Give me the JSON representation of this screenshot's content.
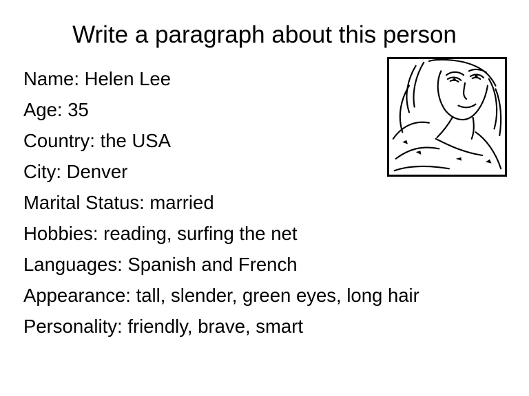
{
  "heading": "Write a paragraph about this person",
  "profile": {
    "lines": [
      "Name: Helen Lee",
      "Age: 35",
      "Country: the USA",
      "City: Denver",
      "Marital Status: married",
      "Hobbies: reading, surfing the net",
      "Languages: Spanish and French",
      "Appearance: tall, slender, green eyes, long hair",
      "Personality: friendly, brave, smart"
    ]
  },
  "photo": {
    "icon": "woman-portrait-icon",
    "style": "black-and-white sketch"
  },
  "colors": {
    "text": "#000000",
    "background": "#ffffff"
  }
}
